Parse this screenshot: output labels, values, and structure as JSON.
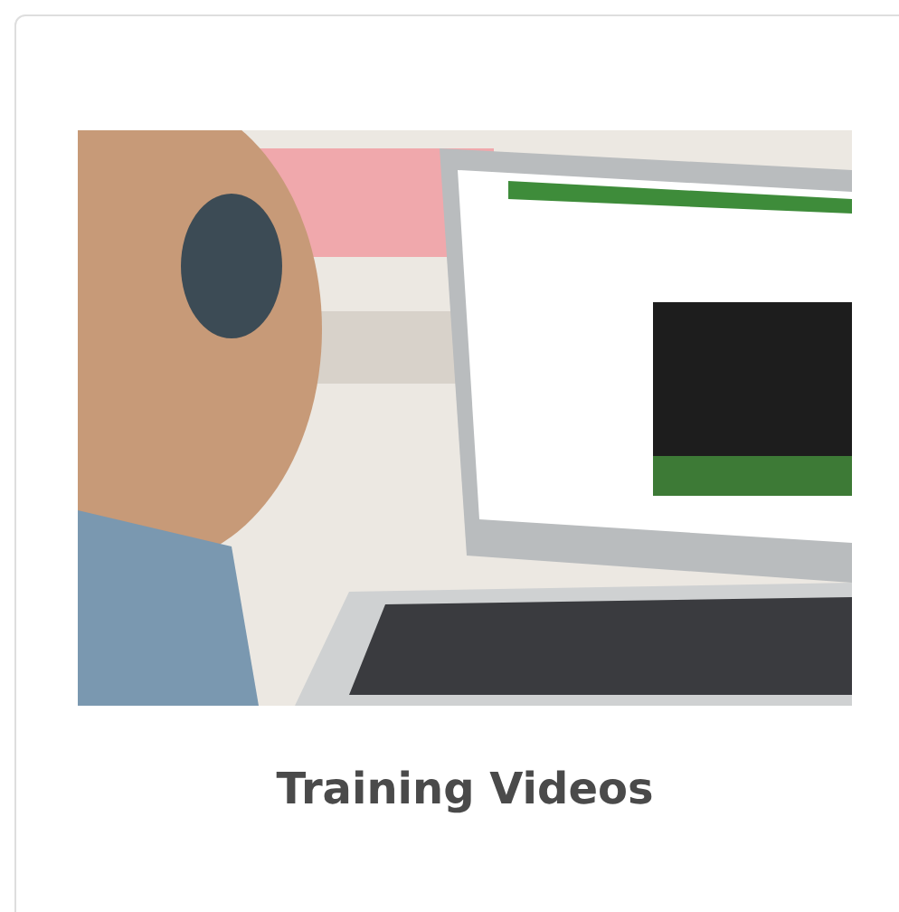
{
  "card": {
    "title": "Training Videos"
  }
}
